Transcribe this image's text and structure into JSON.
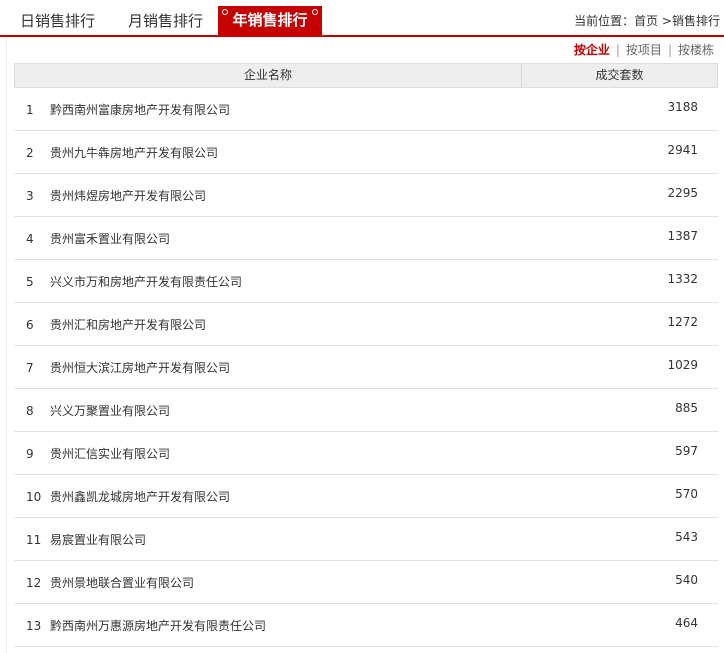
{
  "tabs": [
    {
      "label": "日销售排行"
    },
    {
      "label": "月销售排行"
    },
    {
      "label": "年销售排行"
    }
  ],
  "breadcrumb": {
    "prefix": "当前位置：",
    "home": "首页",
    "arrow": " >",
    "current": "销售排行"
  },
  "sort": {
    "options": [
      {
        "label": "按企业"
      },
      {
        "label": "按项目"
      },
      {
        "label": "按楼栋"
      }
    ],
    "separator": "|"
  },
  "table": {
    "headers": {
      "name": "企业名称",
      "count": "成交套数"
    },
    "rows": [
      {
        "rank": "1",
        "name": "黔西南州富康房地产开发有限公司",
        "count": "3188"
      },
      {
        "rank": "2",
        "name": "贵州九牛犇房地产开发有限公司",
        "count": "2941"
      },
      {
        "rank": "3",
        "name": "贵州炜煜房地产开发有限公司",
        "count": "2295"
      },
      {
        "rank": "4",
        "name": "贵州富禾置业有限公司",
        "count": "1387"
      },
      {
        "rank": "5",
        "name": "兴义市万和房地产开发有限责任公司",
        "count": "1332"
      },
      {
        "rank": "6",
        "name": "贵州汇和房地产开发有限公司",
        "count": "1272"
      },
      {
        "rank": "7",
        "name": "贵州恒大滨江房地产开发有限公司",
        "count": "1029"
      },
      {
        "rank": "8",
        "name": "兴义万聚置业有限公司",
        "count": "885"
      },
      {
        "rank": "9",
        "name": "贵州汇信实业有限公司",
        "count": "597"
      },
      {
        "rank": "10",
        "name": "贵州鑫凯龙城房地产开发有限公司",
        "count": "570"
      },
      {
        "rank": "11",
        "name": "易宸置业有限公司",
        "count": "543"
      },
      {
        "rank": "12",
        "name": "贵州景地联合置业有限公司",
        "count": "540"
      },
      {
        "rank": "13",
        "name": "黔西南州万惠源房地产开发有限责任公司",
        "count": "464"
      }
    ]
  },
  "colors": {
    "accent": "#c40000",
    "header_bg": "#eeeeee",
    "row_border": "#e2e2e2"
  }
}
